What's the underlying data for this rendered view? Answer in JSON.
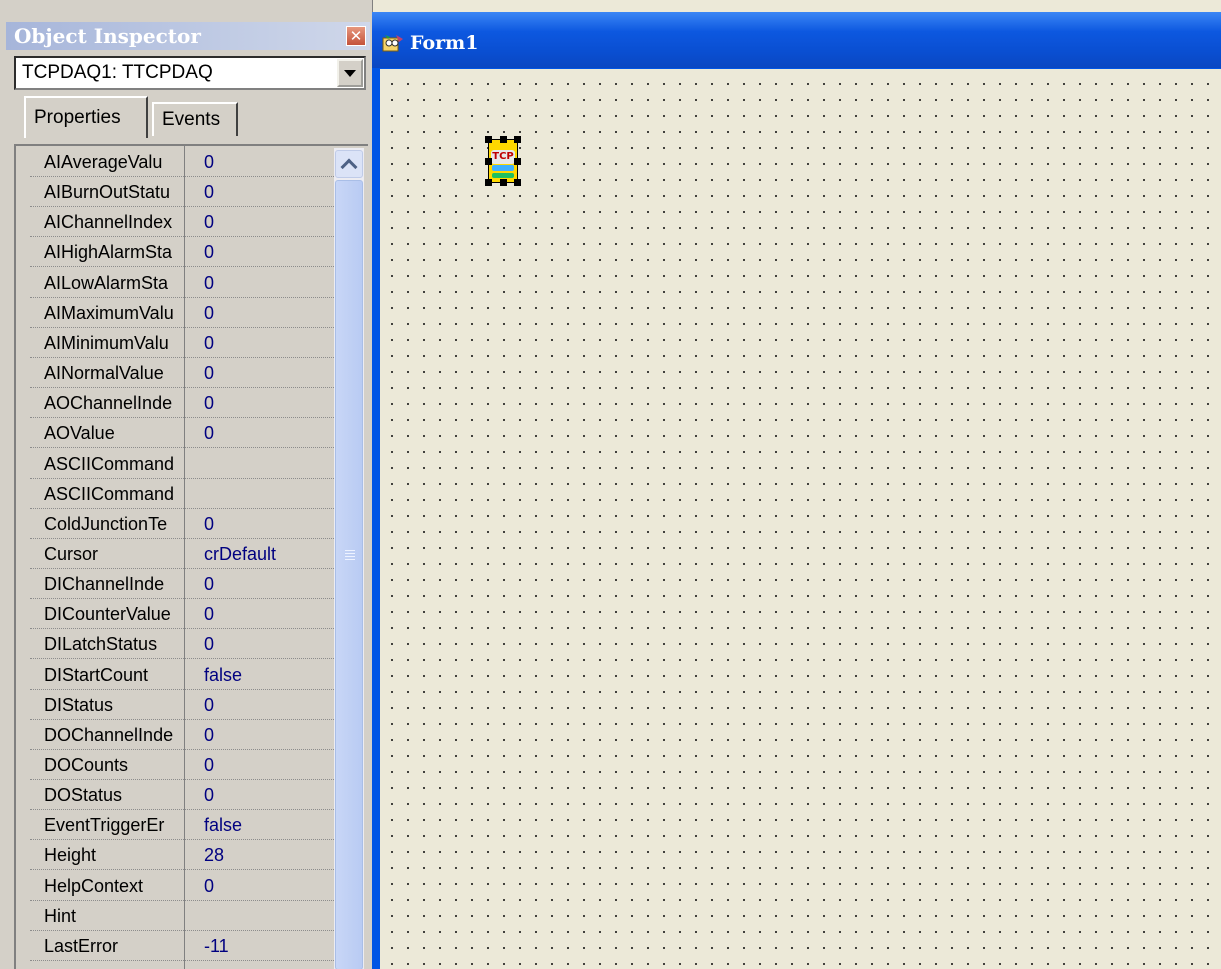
{
  "object_inspector": {
    "title": "Object Inspector",
    "close_icon": "close-icon",
    "selected_object": "TCPDAQ1: TTCPDAQ",
    "tabs": [
      {
        "label": "Properties",
        "active": true
      },
      {
        "label": "Events",
        "active": false
      }
    ],
    "properties": [
      {
        "name": "AIAverageValu",
        "value": "0"
      },
      {
        "name": "AIBurnOutStatu",
        "value": "0"
      },
      {
        "name": "AIChannelIndex",
        "value": "0"
      },
      {
        "name": "AIHighAlarmSta",
        "value": "0"
      },
      {
        "name": "AILowAlarmSta",
        "value": "0"
      },
      {
        "name": "AIMaximumValu",
        "value": "0"
      },
      {
        "name": "AIMinimumValu",
        "value": "0"
      },
      {
        "name": "AINormalValue",
        "value": "0"
      },
      {
        "name": "AOChannelInde",
        "value": "0"
      },
      {
        "name": "AOValue",
        "value": "0"
      },
      {
        "name": "ASCIICommand",
        "value": ""
      },
      {
        "name": "ASCIICommand",
        "value": ""
      },
      {
        "name": "ColdJunctionTe",
        "value": "0"
      },
      {
        "name": "Cursor",
        "value": "crDefault"
      },
      {
        "name": "DIChannelInde",
        "value": "0"
      },
      {
        "name": "DICounterValue",
        "value": "0"
      },
      {
        "name": "DILatchStatus",
        "value": "0"
      },
      {
        "name": "DIStartCount",
        "value": "false"
      },
      {
        "name": "DIStatus",
        "value": "0"
      },
      {
        "name": "DOChannelInde",
        "value": "0"
      },
      {
        "name": "DOCounts",
        "value": "0"
      },
      {
        "name": "DOStatus",
        "value": "0"
      },
      {
        "name": "EventTriggerEr",
        "value": "false"
      },
      {
        "name": "Height",
        "value": "28"
      },
      {
        "name": "HelpContext",
        "value": "0"
      },
      {
        "name": "Hint",
        "value": ""
      },
      {
        "name": "LastError",
        "value": "-11"
      }
    ]
  },
  "form": {
    "title": "Form1",
    "component_label": "TCP"
  }
}
